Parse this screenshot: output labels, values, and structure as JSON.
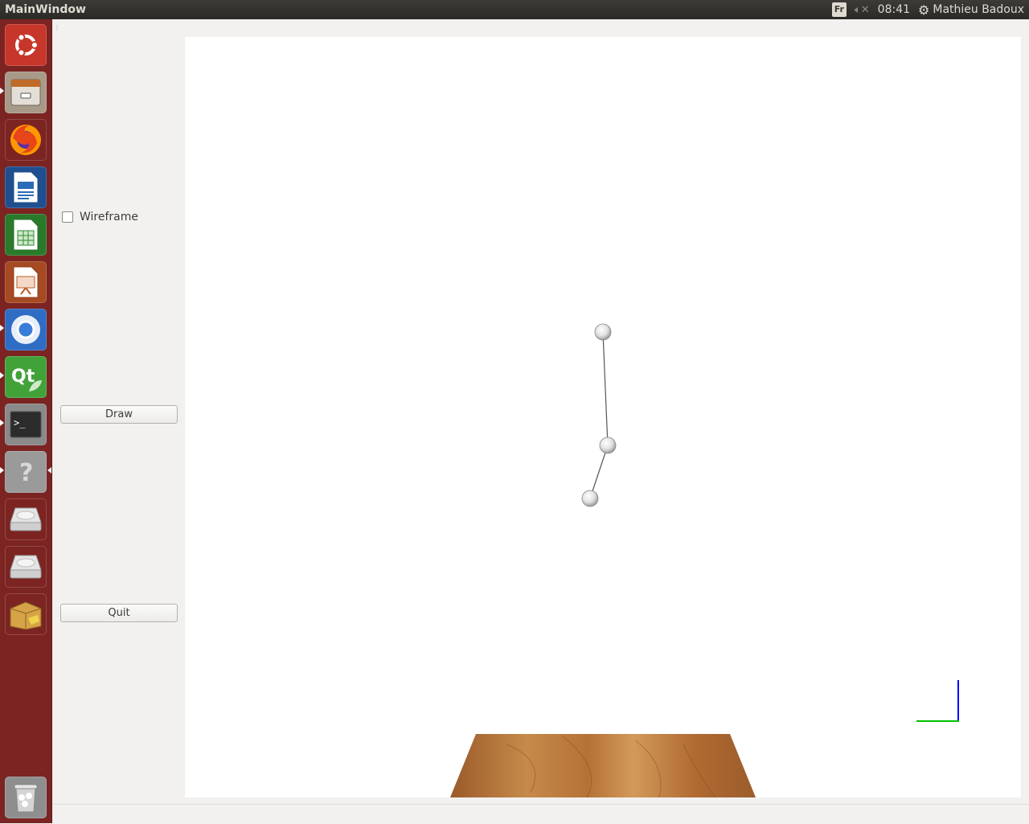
{
  "top_panel": {
    "window_title": "MainWindow",
    "keyboard_layout": "Fr",
    "volume_icon": "volume-muted-icon",
    "clock": "08:41",
    "user_name": "Mathieu Badoux"
  },
  "launcher": {
    "items": [
      {
        "name": "ubuntu-dash",
        "icon": "ubuntu-logo-icon",
        "color": "#d84b2f"
      },
      {
        "name": "files",
        "icon": "file-cabinet-icon",
        "color": "#8a7f72"
      },
      {
        "name": "firefox",
        "icon": "firefox-icon",
        "color": "#e8741a"
      },
      {
        "name": "libreoffice-writer",
        "icon": "writer-document-icon",
        "color": "#2a6bb8"
      },
      {
        "name": "libreoffice-calc",
        "icon": "calc-spreadsheet-icon",
        "color": "#2f8a32"
      },
      {
        "name": "libreoffice-impress",
        "icon": "impress-presentation-icon",
        "color": "#c05a2a"
      },
      {
        "name": "chromium",
        "icon": "chromium-icon",
        "color": "#3a7dd8"
      },
      {
        "name": "qt-creator",
        "icon": "qt-logo-icon",
        "color": "#41a23a"
      },
      {
        "name": "terminal",
        "icon": "terminal-icon",
        "color": "#2c2c2c"
      },
      {
        "name": "help",
        "icon": "help-question-icon",
        "color": "#8f8f8f"
      },
      {
        "name": "drive-1",
        "icon": "hard-drive-icon",
        "color": "#bcbcbc"
      },
      {
        "name": "drive-2",
        "icon": "hard-drive-icon",
        "color": "#bcbcbc"
      },
      {
        "name": "software-center",
        "icon": "software-package-icon",
        "color": "#d6a346"
      },
      {
        "name": "trash",
        "icon": "trash-icon",
        "color": "#bcbcbc"
      }
    ]
  },
  "controls": {
    "wireframe_label": "Wireframe",
    "wireframe_checked": false,
    "draw_label": "Draw",
    "quit_label": "Quit"
  },
  "scene": {
    "background": "#ffffff",
    "joints": 3,
    "axis_colors": {
      "x": "#00c000",
      "y": "#0000ff"
    },
    "floor_texture": "wood"
  }
}
